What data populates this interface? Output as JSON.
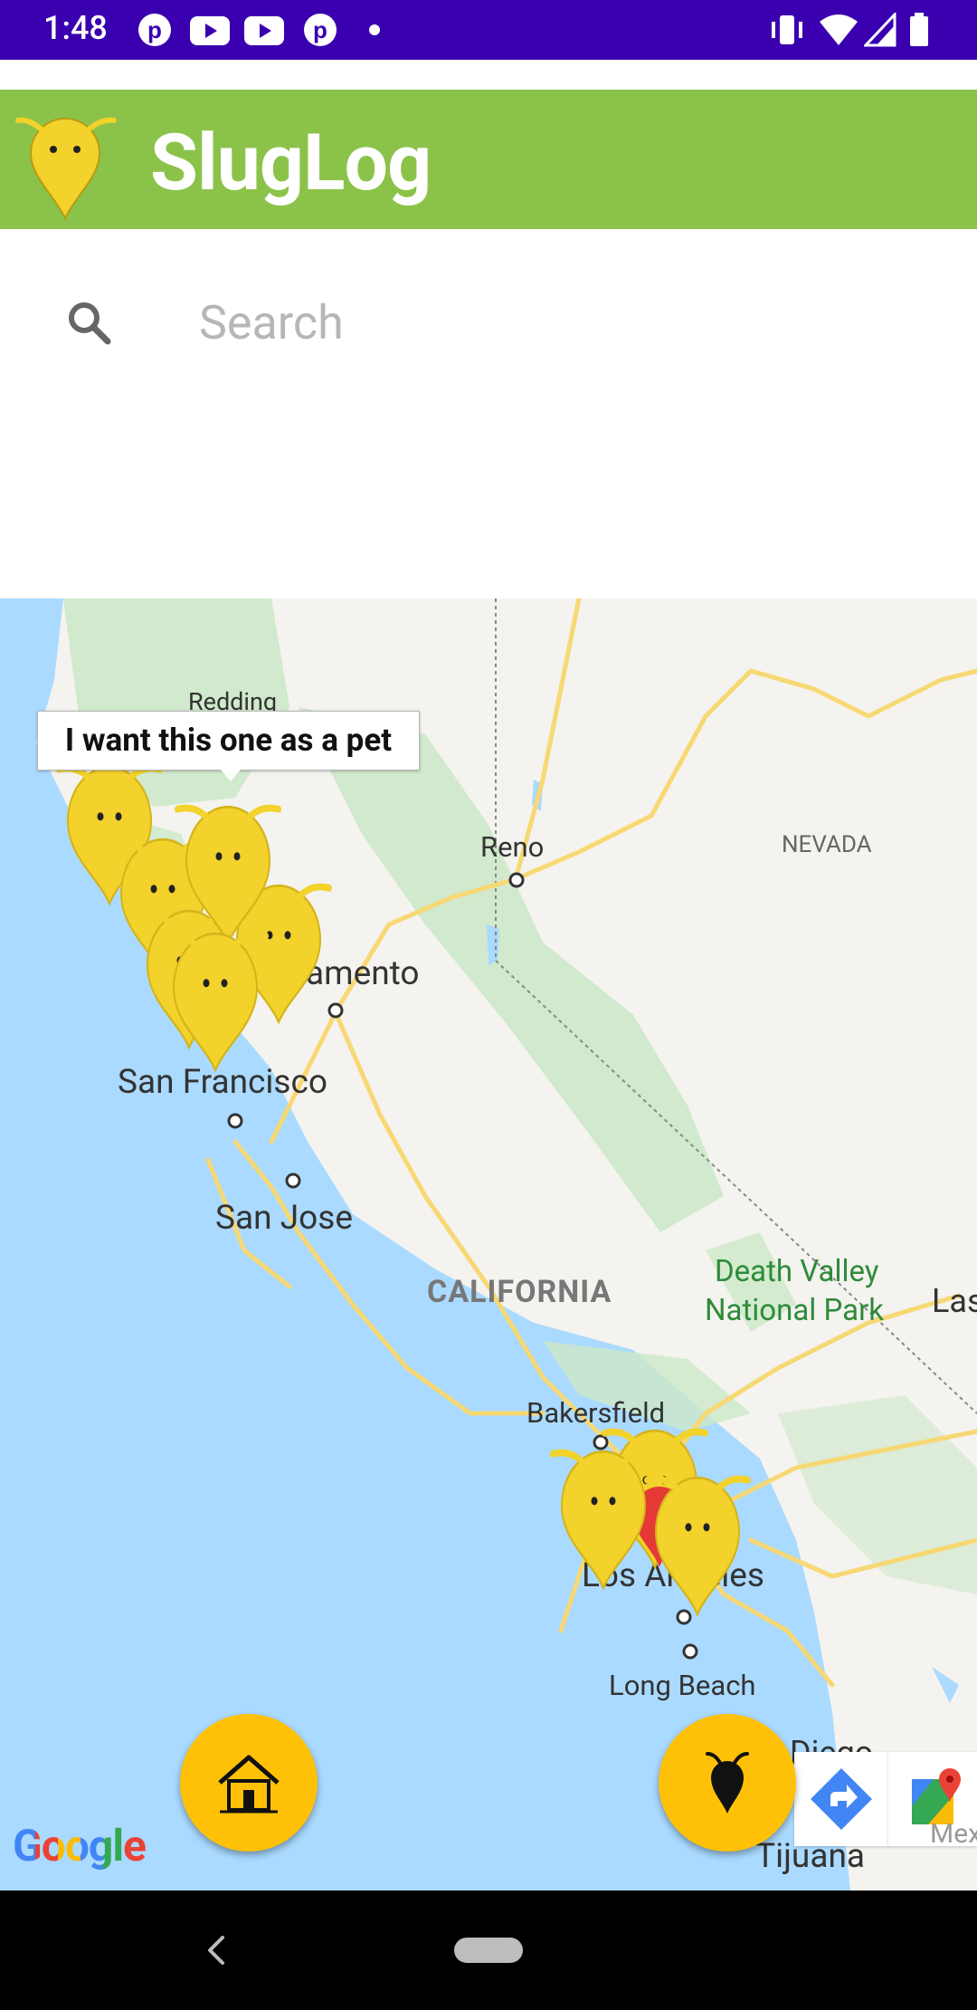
{
  "status_bar": {
    "time": "1:48",
    "notification_icons": [
      "pinterest-icon",
      "youtube-icon",
      "youtube-icon",
      "pinterest-icon",
      "dot-icon"
    ],
    "system_icons": [
      "vibrate-icon",
      "wifi-icon",
      "signal-icon",
      "battery-icon"
    ]
  },
  "app_bar": {
    "title": "SlugLog",
    "logo_icon": "slug-pin-icon",
    "color": "#8bc34a"
  },
  "search": {
    "placeholder": "Search",
    "icon": "search-icon"
  },
  "map": {
    "labels": {
      "redding": "Redding",
      "reno": "Reno",
      "nevada": "NEVADA",
      "sacramento": "amento",
      "san_francisco": "San Francisco",
      "san_jose": "San Jose",
      "california": "CALIFORNIA",
      "death_valley_1": "Death Valley",
      "death_valley_2": "National Park",
      "las": "Las",
      "bakersfield": "Bakersfield",
      "los_angeles": "Los Angeles",
      "long_beach": "Long Beach",
      "diego": "Diego",
      "tijuana": "Tijuana",
      "mex": "Mex"
    },
    "info_window": "I want this one as a pet",
    "marker_color": "#f2d22b",
    "selected_marker_color": "#e53935",
    "attribution": "Google"
  },
  "fabs": {
    "home": "home-icon",
    "add_slug": "slug-icon",
    "color": "#ffc107"
  },
  "map_toolbar": {
    "directions": "directions-icon",
    "open_maps": "google-maps-icon"
  },
  "nav_bar": {
    "back": "back-icon",
    "home": "home-pill-icon"
  }
}
